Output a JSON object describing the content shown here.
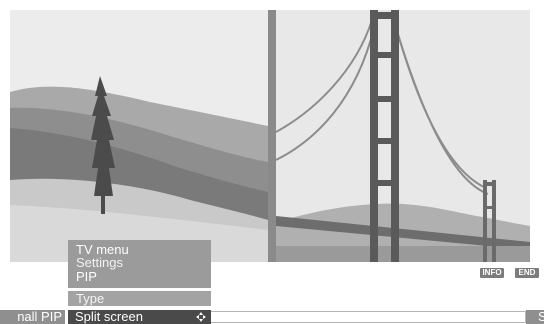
{
  "menu": {
    "line1": "TV menu",
    "line2": "Settings",
    "line3": "PIP",
    "type": "Type"
  },
  "bottom_bar": {
    "left_cell": "nall PIP",
    "selected": "Split screen",
    "selected_icon": "navigate-arrows-icon",
    "right_cell": "S"
  },
  "buttons": {
    "info": "INFO",
    "end": "END"
  },
  "colors": {
    "menu_panel": "#9b9b9b",
    "selected_bar": "#4a4a4a",
    "button": "#7c7c7c"
  }
}
